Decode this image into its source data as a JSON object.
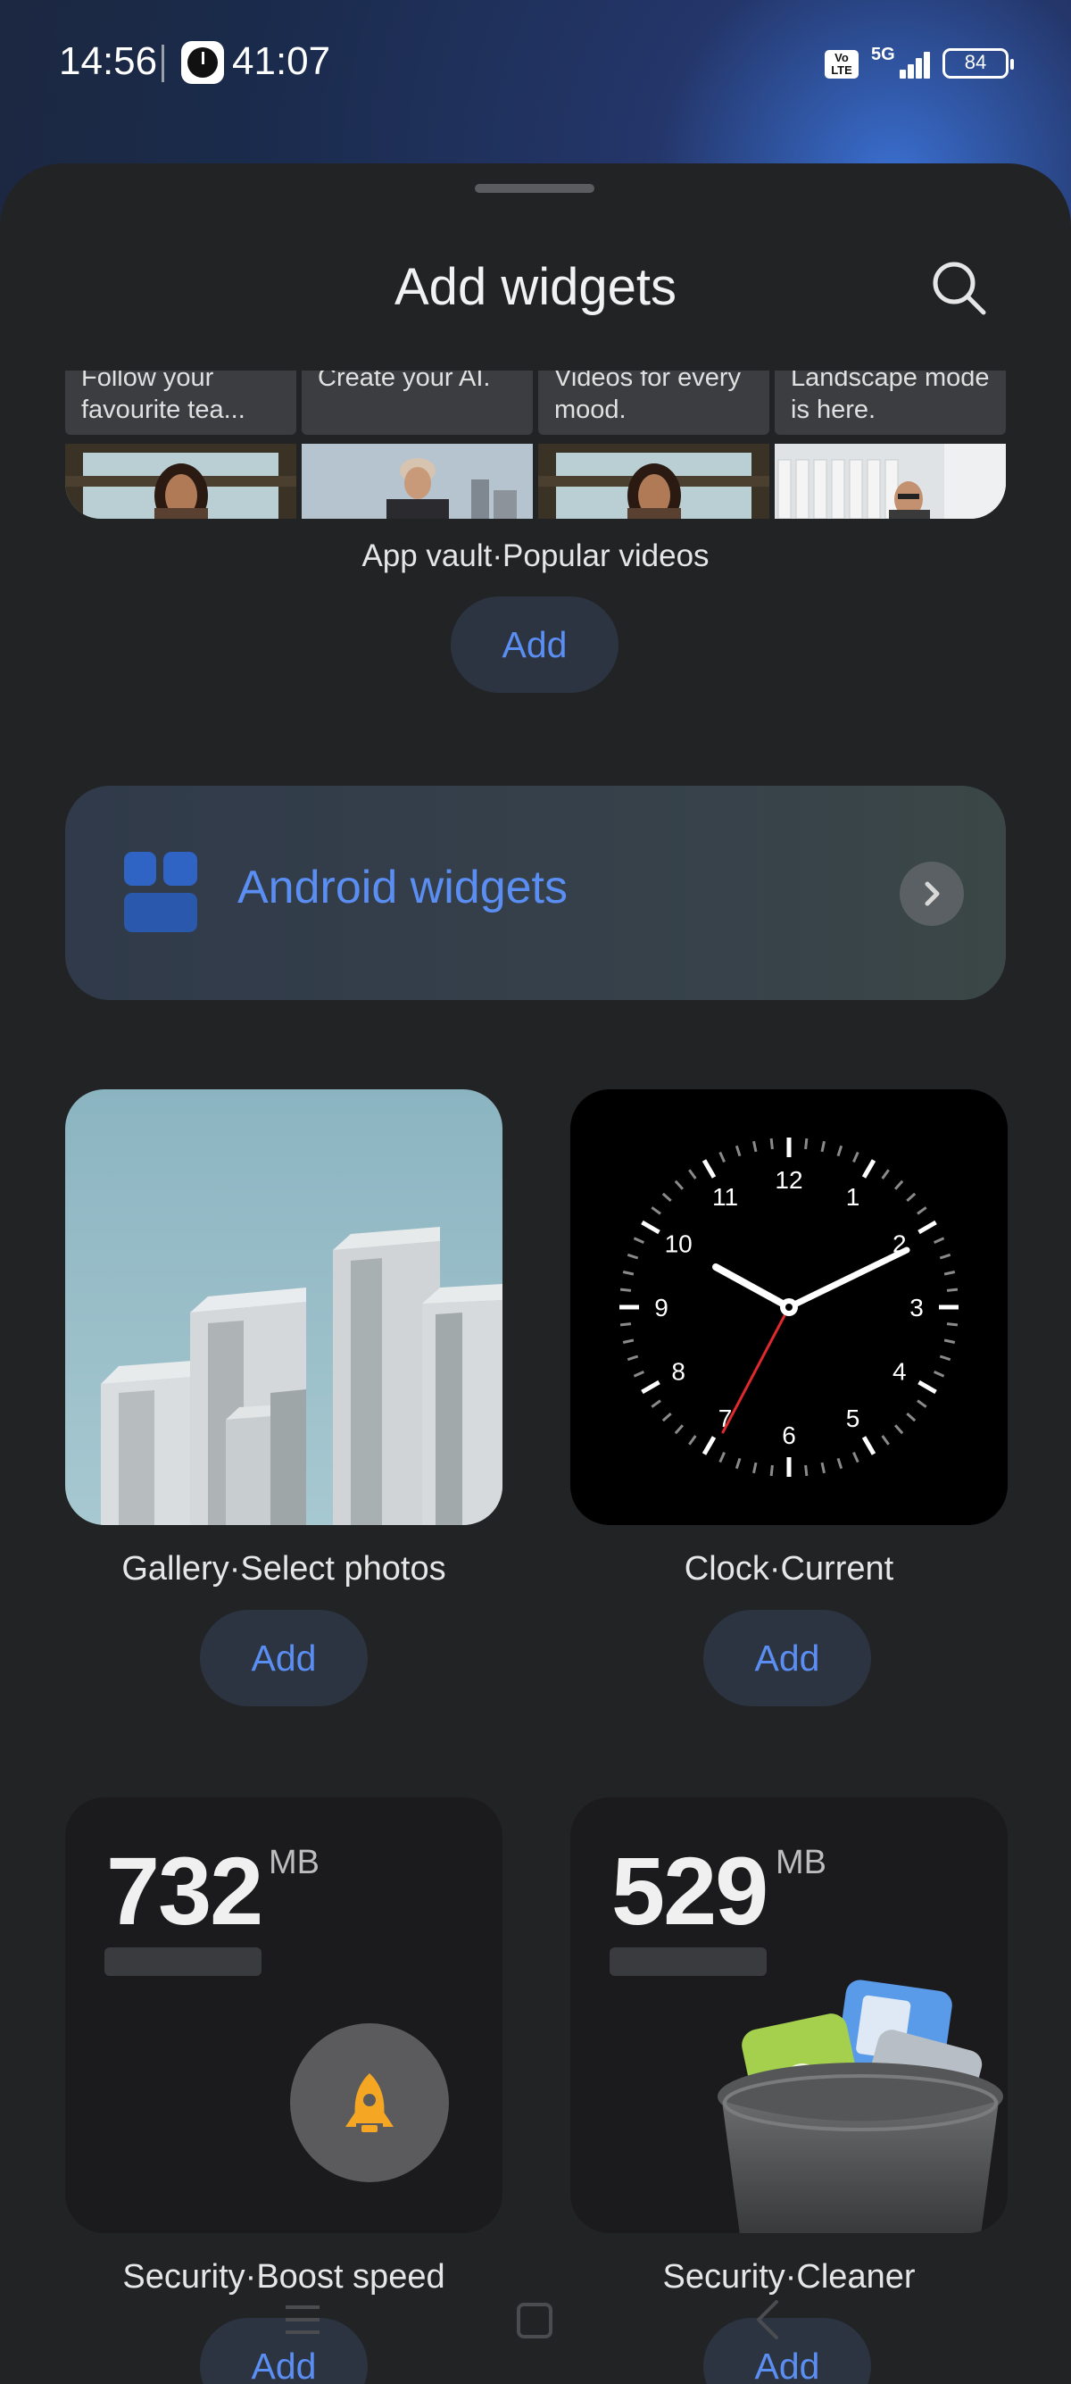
{
  "status_bar": {
    "time": "14:56",
    "timer": "41:07",
    "network": "5G",
    "volte": "Vo LTE",
    "battery": "84"
  },
  "sheet": {
    "title": "Add widgets"
  },
  "app_vault": {
    "cards": [
      {
        "caption": "Follow your favourite tea..."
      },
      {
        "caption": "Create your AI."
      },
      {
        "caption": "Videos for every mood."
      },
      {
        "caption": "Landscape mode is here."
      }
    ],
    "label": "App vault·Popular videos",
    "add_label": "Add"
  },
  "android_widgets": {
    "label": "Android widgets"
  },
  "gallery": {
    "label": "Gallery·Select photos",
    "add_label": "Add"
  },
  "clock": {
    "label": "Clock·Current",
    "add_label": "Add",
    "numerals": [
      "12",
      "1",
      "2",
      "3",
      "4",
      "5",
      "6",
      "7",
      "8",
      "9",
      "10",
      "11"
    ]
  },
  "boost": {
    "value": "732",
    "unit": "MB",
    "label": "Security·Boost speed",
    "add_label": "Add"
  },
  "cleaner": {
    "value": "529",
    "unit": "MB",
    "label": "Security·Cleaner",
    "add_label": "Add"
  },
  "colors": {
    "accent": "#5b8ef2",
    "sheet_bg": "#222325",
    "rocket": "#f5a623"
  }
}
